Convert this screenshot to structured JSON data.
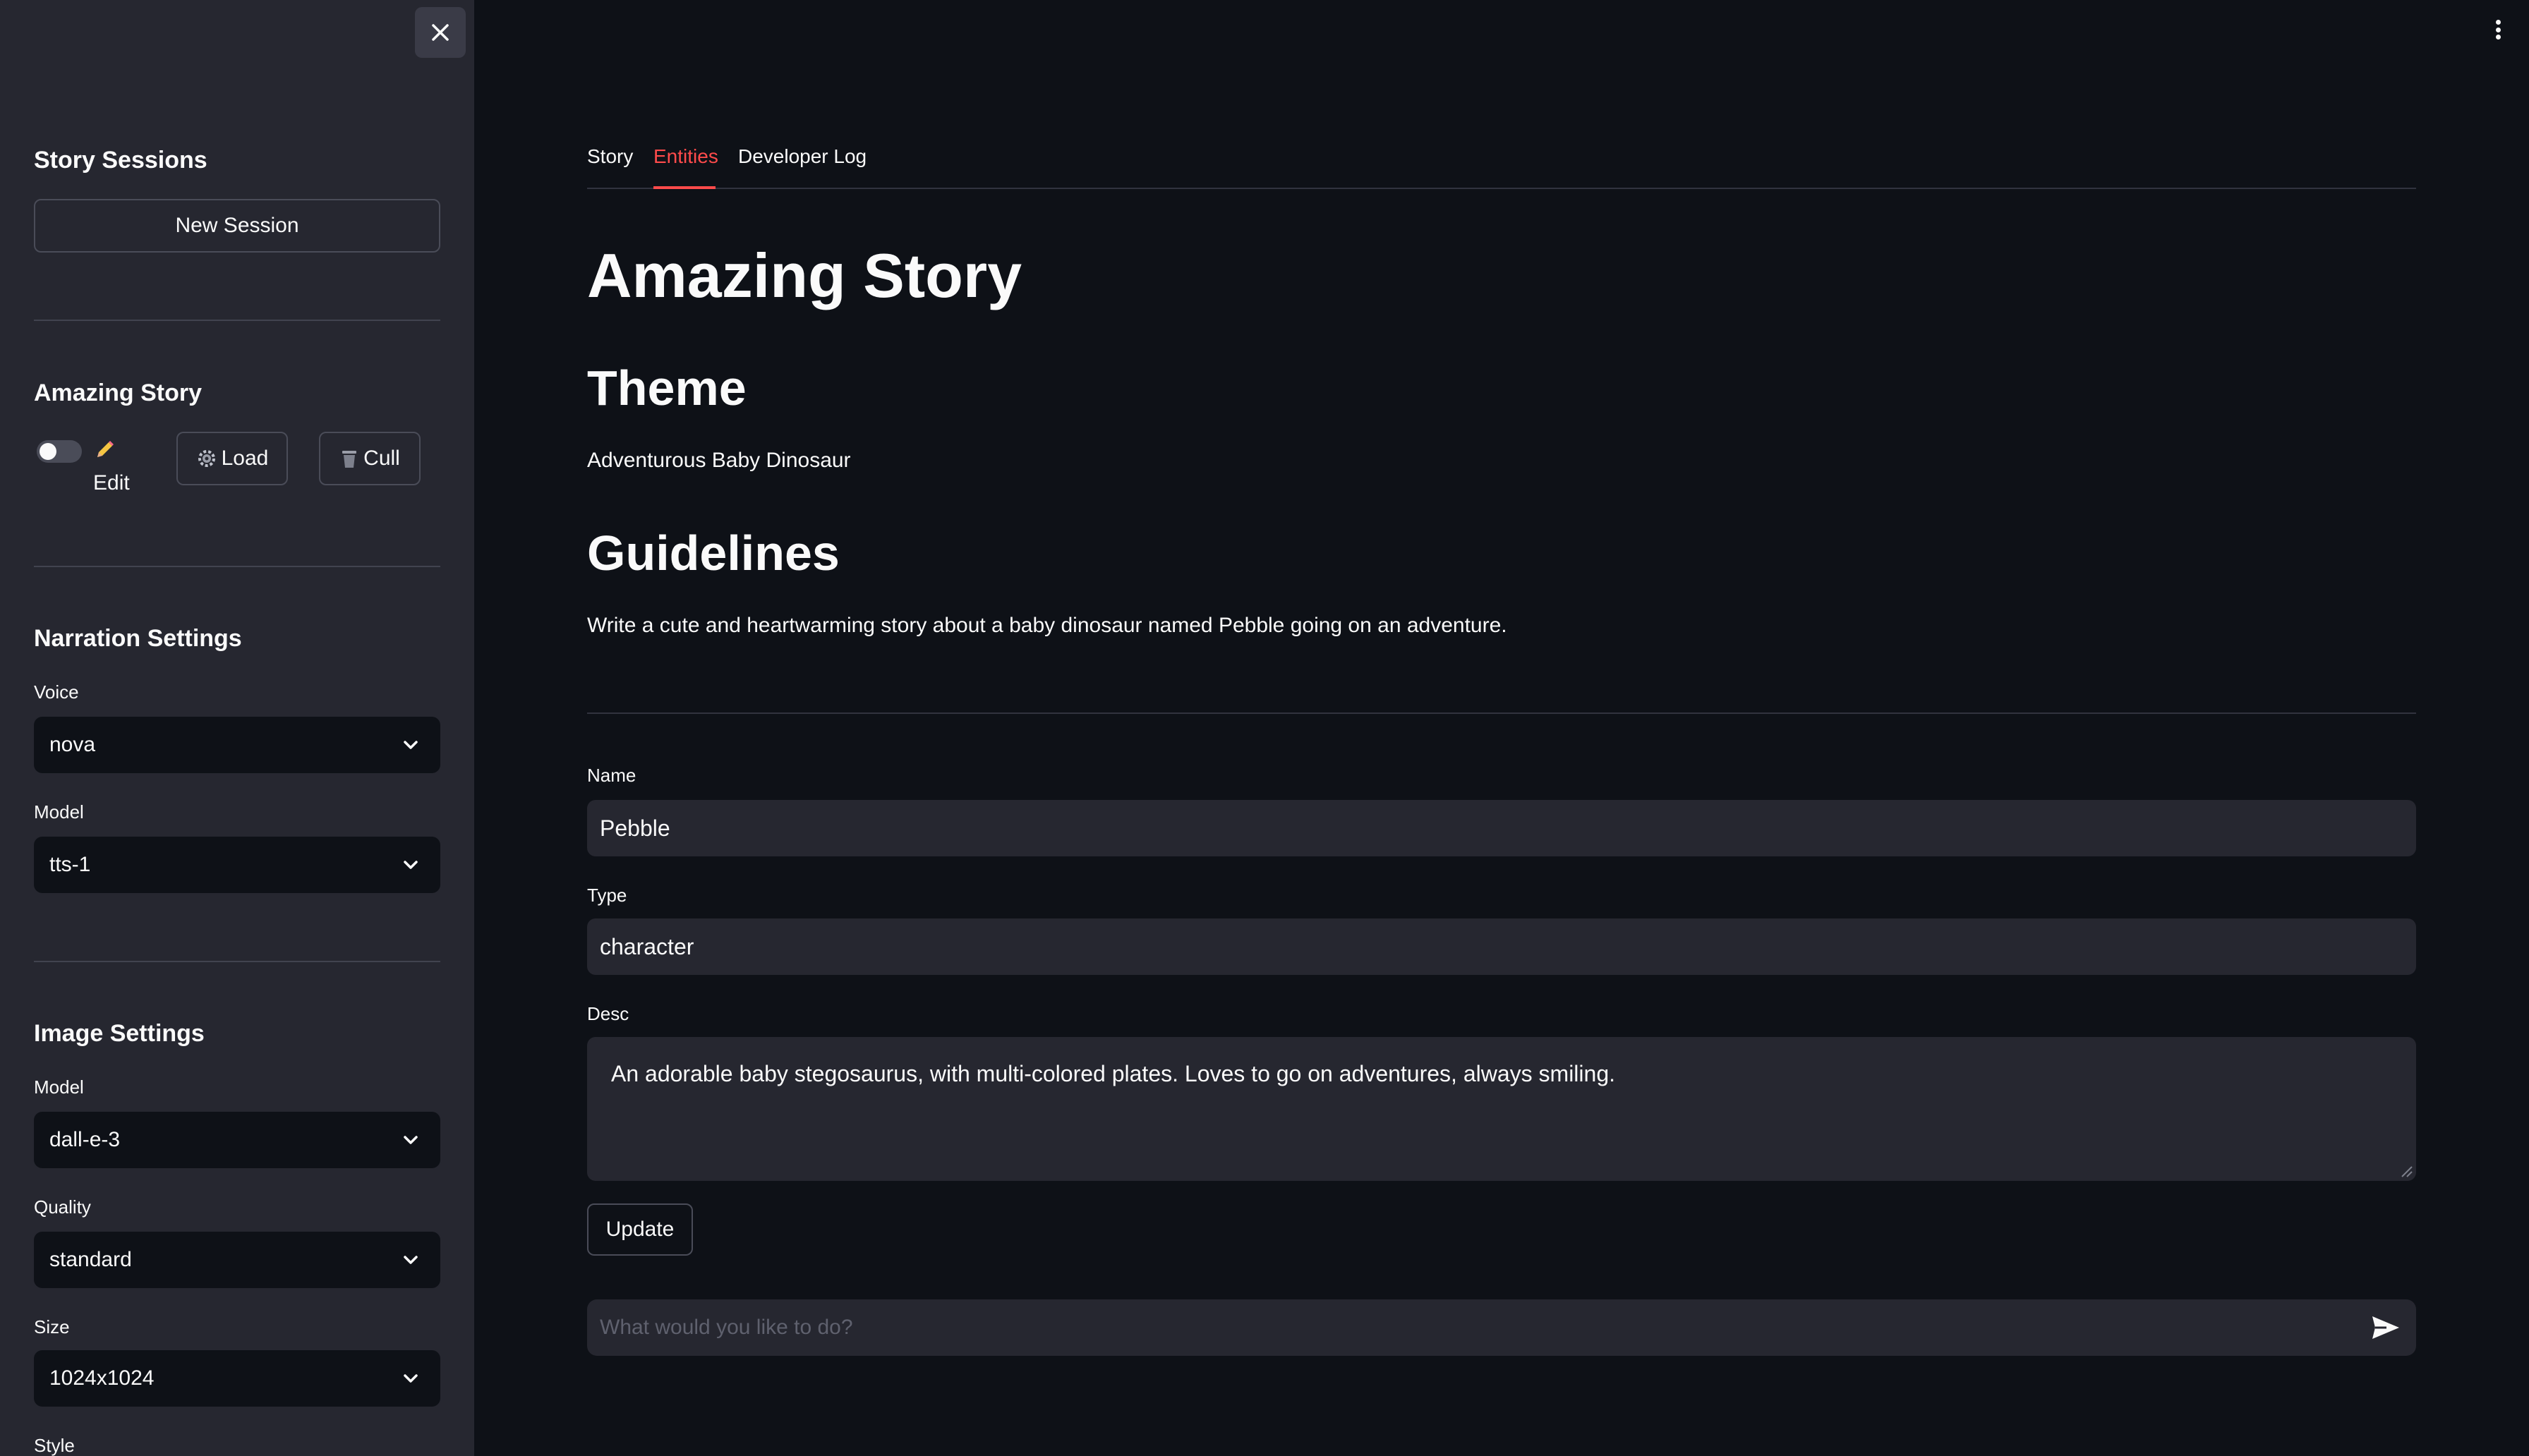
{
  "sidebar": {
    "close_icon": "close-icon",
    "sessions_heading": "Story Sessions",
    "new_session_label": "New Session",
    "story_heading": "Amazing Story",
    "edit_icon": "pencil",
    "edit_label": "Edit",
    "load_icon": "gear-icon",
    "load_label": "Load",
    "cull_icon": "trash-icon",
    "cull_label": "Cull",
    "narration_heading": "Narration Settings",
    "voice_label": "Voice",
    "voice_value": "nova",
    "narration_model_label": "Model",
    "narration_model_value": "tts-1",
    "image_heading": "Image Settings",
    "image_model_label": "Model",
    "image_model_value": "dall-e-3",
    "quality_label": "Quality",
    "quality_value": "standard",
    "size_label": "Size",
    "size_value": "1024x1024",
    "style_label": "Style"
  },
  "tabs": [
    {
      "label": "Story",
      "active": false
    },
    {
      "label": "Entities",
      "active": true
    },
    {
      "label": "Developer Log",
      "active": false
    }
  ],
  "main": {
    "title": "Amazing Story",
    "theme_heading": "Theme",
    "theme_text": "Adventurous Baby Dinosaur",
    "guidelines_heading": "Guidelines",
    "guidelines_text": "Write a cute and heartwarming story about a baby dinosaur named Pebble going on an adventure.",
    "name_label": "Name",
    "name_value": "Pebble",
    "type_label": "Type",
    "type_value": "character",
    "desc_label": "Desc",
    "desc_value": "An adorable baby stegosaurus, with multi-colored plates. Loves to go on adventures, always smiling.",
    "update_label": "Update",
    "chat_placeholder": "What would you like to do?"
  },
  "colors": {
    "background": "#0e1117",
    "sidebar": "#262730",
    "accent": "#ff4b4b",
    "input_bg": "#262730"
  }
}
